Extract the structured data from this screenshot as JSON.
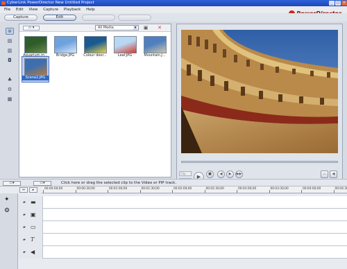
{
  "window": {
    "title": "CyberLink PowerDirector New Untitled Project"
  },
  "menu": [
    "File",
    "Edit",
    "View",
    "Capture",
    "Playback",
    "Help"
  ],
  "brand": {
    "logo_text": "PowerDirector"
  },
  "modes": {
    "capture": "Capture",
    "edit": "Edit"
  },
  "library": {
    "filter": "All Media",
    "items": [
      {
        "label": "Aquarium.m...",
        "colors": [
          "#2f5d2a",
          "#6a8a4a"
        ]
      },
      {
        "label": "Bridge.JPG",
        "colors": [
          "#6fa2dd",
          "#d7e6f5"
        ]
      },
      {
        "label": "Colour door...",
        "colors": [
          "#1b5a90",
          "#e8d24a"
        ]
      },
      {
        "label": "Leaf.JPG",
        "colors": [
          "#b8d7f2",
          "#d63b2b"
        ]
      },
      {
        "label": "Mountain.J...",
        "colors": [
          "#4f7fbf",
          "#d0c7a5"
        ]
      },
      {
        "label": "Scene2.JPG",
        "colors": [
          "#3d6fb0",
          "#b37a3f"
        ],
        "selected": true
      }
    ]
  },
  "status_bar": {
    "hint": "Click here or drag the selected clip to the Video or PIP track."
  },
  "timeline": {
    "ticks": [
      "00:00:00;00",
      "00:00:30;00",
      "00:01:00;00",
      "00:01:30;00",
      "00:02:00;00",
      "00:02:30;00",
      "00:03:00;00",
      "00:03:30;00",
      "00:04:00;00",
      "00:04:30"
    ],
    "tracks": [
      {
        "name": "video-track",
        "icon": "film-icon",
        "glyph": "▬"
      },
      {
        "name": "pip-track",
        "icon": "pip-icon",
        "glyph": "▣"
      },
      {
        "name": "effect-track",
        "icon": "monitor-icon",
        "glyph": "▭"
      },
      {
        "name": "title-track",
        "icon": "title-icon",
        "glyph": "T"
      },
      {
        "name": "voice-track",
        "icon": "speaker-icon",
        "glyph": "◀"
      }
    ]
  }
}
